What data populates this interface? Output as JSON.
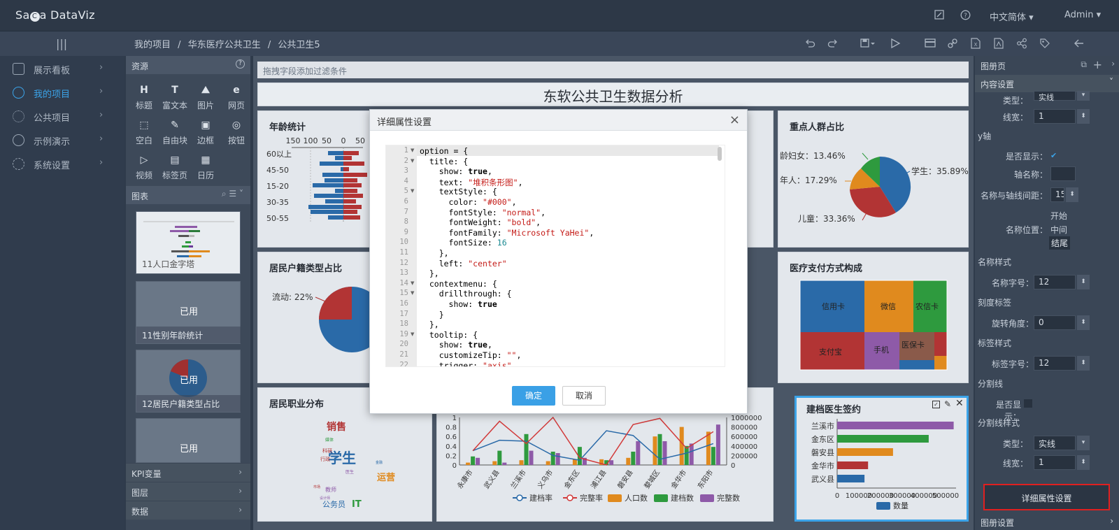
{
  "app": {
    "logo_a": "Sa",
    "logo_b": "a DataViz",
    "logo_mid": "C"
  },
  "topbar": {
    "language": "中文简体",
    "user": "Admin"
  },
  "breadcrumb": [
    "我的项目",
    "华东医疗公共卫生",
    "公共卫生5"
  ],
  "nav": [
    {
      "label": "展示看板"
    },
    {
      "label": "我的项目"
    },
    {
      "label": "公共项目"
    },
    {
      "label": "示例演示"
    },
    {
      "label": "系统设置"
    }
  ],
  "resources": {
    "title": "资源",
    "items": [
      {
        "glyph": "H",
        "label": "标题"
      },
      {
        "glyph": "T",
        "label": "富文本"
      },
      {
        "glyph": "⛰",
        "label": "图片"
      },
      {
        "glyph": "e",
        "label": "网页"
      },
      {
        "glyph": "⬚",
        "label": "空白"
      },
      {
        "glyph": "✎",
        "label": "自由块"
      },
      {
        "glyph": "▣",
        "label": "边框"
      },
      {
        "glyph": "◎",
        "label": "按钮"
      },
      {
        "glyph": "▷",
        "label": "视频"
      },
      {
        "glyph": "▤",
        "label": "标签页"
      },
      {
        "glyph": "▦",
        "label": "日历"
      }
    ],
    "charts_title": "图表",
    "thumbs": [
      {
        "label": "11人口金字塔",
        "used": ""
      },
      {
        "label": "11性别年龄统计",
        "used": "已用"
      },
      {
        "label": "12居民户籍类型占比",
        "used": "已用"
      },
      {
        "label": "",
        "used": "已用"
      }
    ],
    "accordions": [
      "KPI变量",
      "图层",
      "数据"
    ]
  },
  "canvas": {
    "filter_placeholder": "拖拽字段添加过滤条件",
    "dashboard_title": "东软公共卫生数据分析",
    "cards": {
      "age": {
        "title": "年龄统计",
        "ticks": [
          "150",
          "100",
          "50",
          "0",
          "50"
        ],
        "rows": [
          "60以上",
          "45-50",
          "15-20",
          "30-35",
          "50-55"
        ]
      },
      "focus": {
        "title": "重点人群占比",
        "labels": [
          "龄妇女：13.46%",
          "学生：35.89%",
          "年人：17.29%",
          "儿童：33.36%"
        ]
      },
      "hukou": {
        "title": "居民户籍类型占比",
        "label": "流动: 22%"
      },
      "pay": {
        "title": "医疗支付方式构成",
        "cells": [
          "信用卡",
          "微信",
          "农信卡",
          "支付宝",
          "手机",
          "医保卡"
        ]
      },
      "job": {
        "title": "居民职业分布",
        "words": [
          "销售",
          "学生",
          "运营",
          "IT",
          "公务员",
          "教师",
          "科研",
          "行政",
          "媒体",
          "医生",
          "金融",
          "市场",
          "设计师"
        ]
      },
      "trend": {
        "cities": [
          "永康市",
          "武义县",
          "兰溪市",
          "义乌市",
          "金东区",
          "浦江县",
          "磐安县",
          "婺城区",
          "金华市",
          "东阳市"
        ],
        "left_ticks": [
          "1",
          "0.8",
          "0.6",
          "0.4",
          "0.2",
          "0"
        ],
        "right_ticks": [
          "1000000",
          "800000",
          "600000",
          "400000",
          "200000",
          "0"
        ],
        "legend": [
          "建档率",
          "完整率",
          "人口数",
          "建档数",
          "完整数"
        ]
      },
      "doctor": {
        "title": "建档医生签约",
        "cats": [
          "兰溪市",
          "金东区",
          "磐安县",
          "金华市",
          "武义县"
        ],
        "ticks": [
          "0",
          "100000",
          "200000",
          "300000",
          "400000",
          "500000"
        ],
        "legend": "数量"
      }
    }
  },
  "rpanel": {
    "title": "图册页",
    "section": "内容设置",
    "rows": [
      {
        "label": "类型：",
        "value": "实线"
      },
      {
        "label": "线宽：",
        "value": "1"
      }
    ],
    "yaxis": "y轴",
    "show_label": "是否显示：",
    "axis_name_label": "轴名称：",
    "name_gap_label": "名称与轴线间距：",
    "name_gap_value": "15",
    "name_pos_label": "名称位置：",
    "name_pos_options": [
      "开始",
      "中间",
      "结尾"
    ],
    "name_style": "名称样式",
    "name_font_label": "名称字号：",
    "name_font_value": "12",
    "tick_label": "刻度标签",
    "rotate_label": "旋转角度：",
    "rotate_value": "0",
    "tick_style": "标签样式",
    "tick_font_label": "标签字号：",
    "tick_font_value": "12",
    "split_line": "分割线",
    "split_show_label": "是否显示：",
    "split_style": "分割线样式",
    "split_type_label": "类型：",
    "split_type_value": "实线",
    "split_width_label": "线宽：",
    "split_width_value": "1",
    "detail_button": "详细属性设置",
    "footer": "图册设置"
  },
  "modal": {
    "title": "详细属性设置",
    "ok": "确定",
    "cancel": "取消",
    "lines": [
      "option = {",
      "  title: {",
      "    show: true,",
      "    text: \"堆积条形图\",",
      "    textStyle: {",
      "      color: \"#000\",",
      "      fontStyle: \"normal\",",
      "      fontWeight: \"bold\",",
      "      fontFamily: \"Microsoft YaHei\",",
      "      fontSize: 16",
      "    },",
      "    left: \"center\"",
      "  },",
      "  contextmenu: {",
      "    drillthrough: {",
      "      show: true",
      "    }",
      "  },",
      "  tooltip: {",
      "    show: true,",
      "    customizeTip: \"\",",
      "    trigger: \"axis\""
    ]
  }
}
